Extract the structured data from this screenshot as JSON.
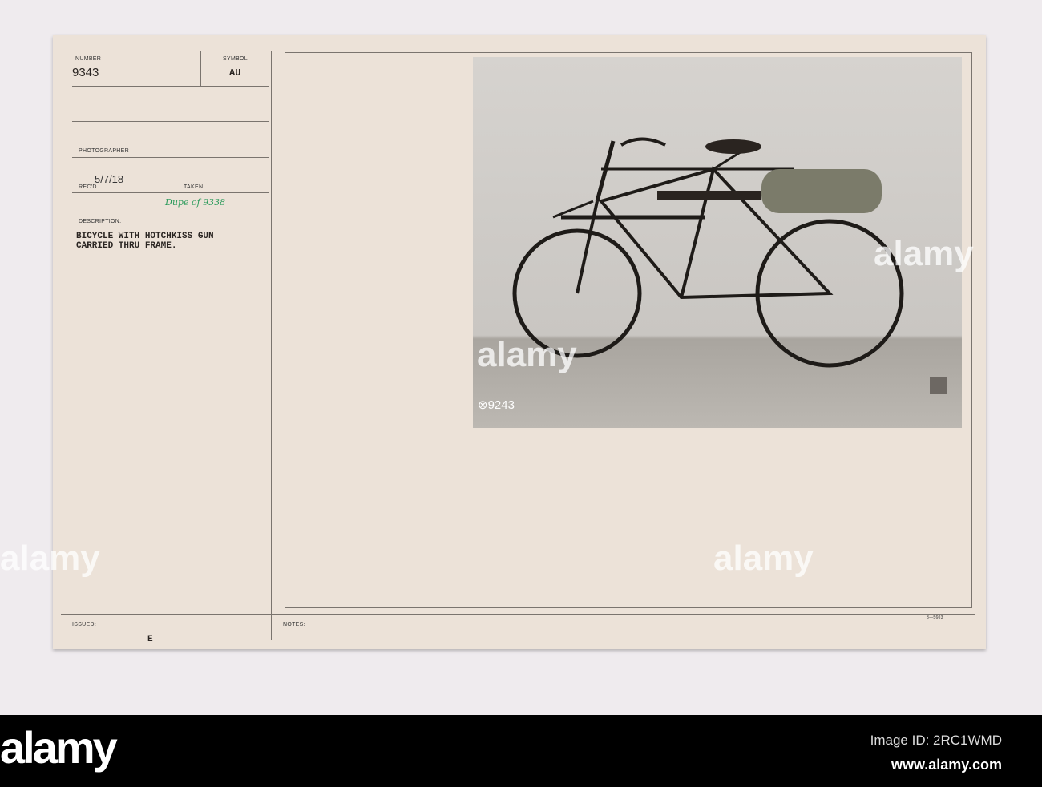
{
  "card": {
    "number_label": "NUMBER",
    "number": "9343",
    "symbol_label": "SYMBOL",
    "symbol": "AU",
    "photographer_label": "PHOTOGRAPHER",
    "recd_label": "REC'D",
    "recd": "5/7/18",
    "taken_label": "TAKEN",
    "annotation": "Dupe of 9338",
    "description_label": "DESCRIPTION:",
    "description_line1": "BICYCLE WITH HOTCHKISS GUN",
    "description_line2": "CARRIED THRU FRAME.",
    "issued_label": "ISSUED:",
    "issued": "E",
    "notes_label": "NOTES:",
    "form_number": "3—5603",
    "photo_number": "⊗9243"
  },
  "footer": {
    "logo": "alamy",
    "image_id": "Image ID: 2RC1WMD",
    "url": "www.alamy.com"
  },
  "watermark": "alamy"
}
